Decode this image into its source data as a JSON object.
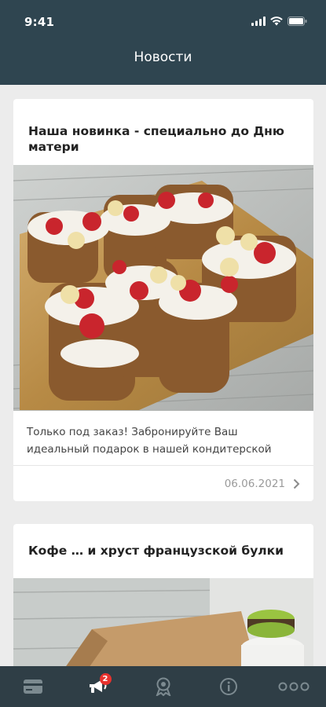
{
  "status_bar": {
    "time": "9:41"
  },
  "header": {
    "title": "Новости"
  },
  "feed": {
    "cards": [
      {
        "title": "Наша новинка - специально до Дню матери",
        "image": "cake-photo",
        "text": "Только под заказ! Забронируйте Ваш идеальный подарок в нашей кондитерской",
        "date": "06.06.2021"
      },
      {
        "title": "Кофе … и хруст французской булки",
        "image": "coffee-macaron-photo"
      }
    ]
  },
  "tabbar": {
    "tabs": [
      {
        "icon": "card-icon",
        "active": false
      },
      {
        "icon": "megaphone-icon",
        "active": true,
        "badge": "2"
      },
      {
        "icon": "award-icon",
        "active": false
      },
      {
        "icon": "info-icon",
        "active": false
      },
      {
        "icon": "more-icon",
        "active": false
      }
    ]
  },
  "colors": {
    "header_bg": "#2f4550",
    "tabbar_bg": "#2f3e46",
    "badge": "#e8322e",
    "page_bg": "#ececec"
  }
}
